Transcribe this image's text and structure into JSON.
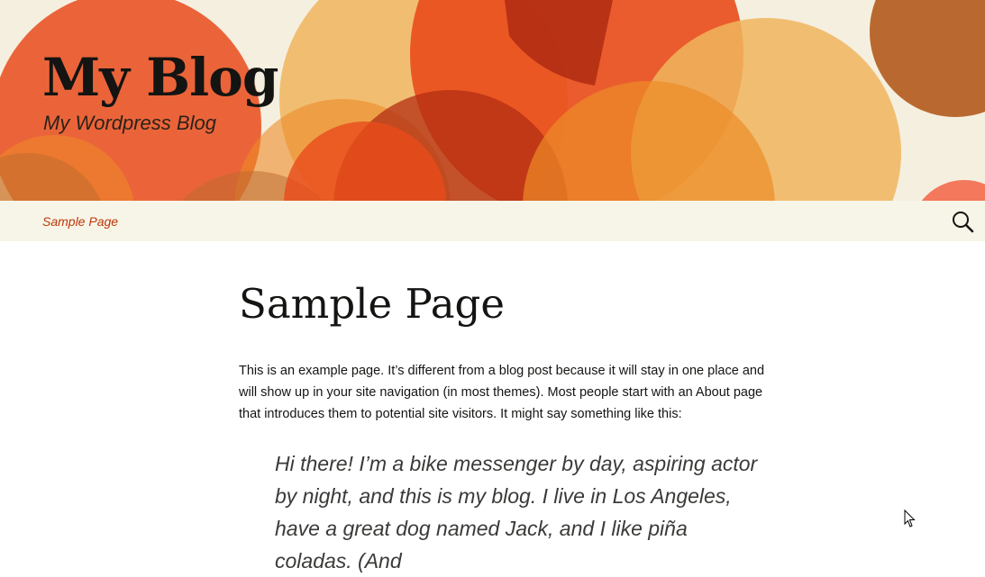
{
  "header": {
    "site_title": "My Blog",
    "site_description": "My Wordpress Blog",
    "colors": {
      "banner_bg": "#f5efe0",
      "orange_light": "#f0b55d",
      "orange": "#ec8b28",
      "red_orange": "#e94b1b",
      "deep_red": "#b32d14",
      "brown": "#b9692f",
      "coral": "#f46a4e"
    }
  },
  "nav": {
    "items": [
      {
        "label": "Sample Page"
      }
    ],
    "search_icon": "search-icon",
    "link_color": "#bc360a",
    "bg_color": "#f7f5e7"
  },
  "page": {
    "title": "Sample Page",
    "paragraph": "This is an example page. It’s different from a blog post because it will stay in one place and will show up in your site navigation (in most themes). Most people start with an About page that introduces them to potential site visitors. It might say something like this:",
    "quote": "Hi there! I’m a bike messenger by day, aspiring actor by night, and this is my blog. I live in Los Angeles, have a great dog named Jack, and I like piña coladas. (And"
  },
  "cursor_icon": "arrow-cursor-icon"
}
